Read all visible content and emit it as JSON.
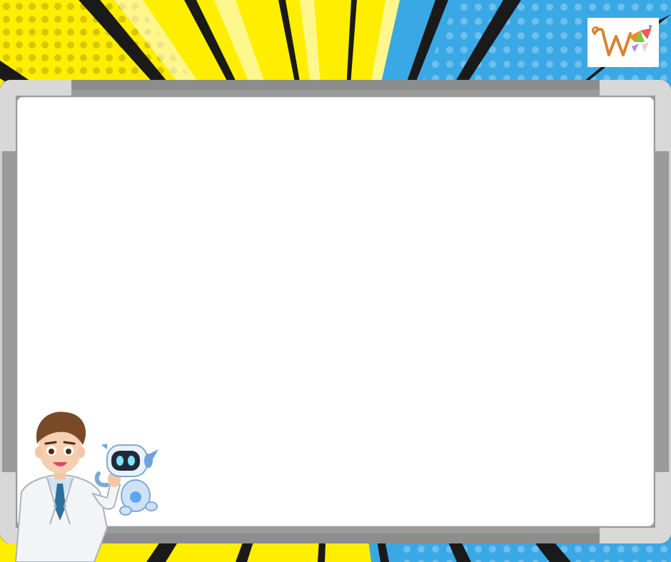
{
  "colors": {
    "yellow": "#ffee00",
    "blue": "#3ba8e6",
    "board": "#ffffff",
    "frame": "#9a9a9a"
  },
  "icons": {
    "logo": "w-logo-icon",
    "teacher": "teacher-illustration",
    "robot": "robot-illustration"
  }
}
